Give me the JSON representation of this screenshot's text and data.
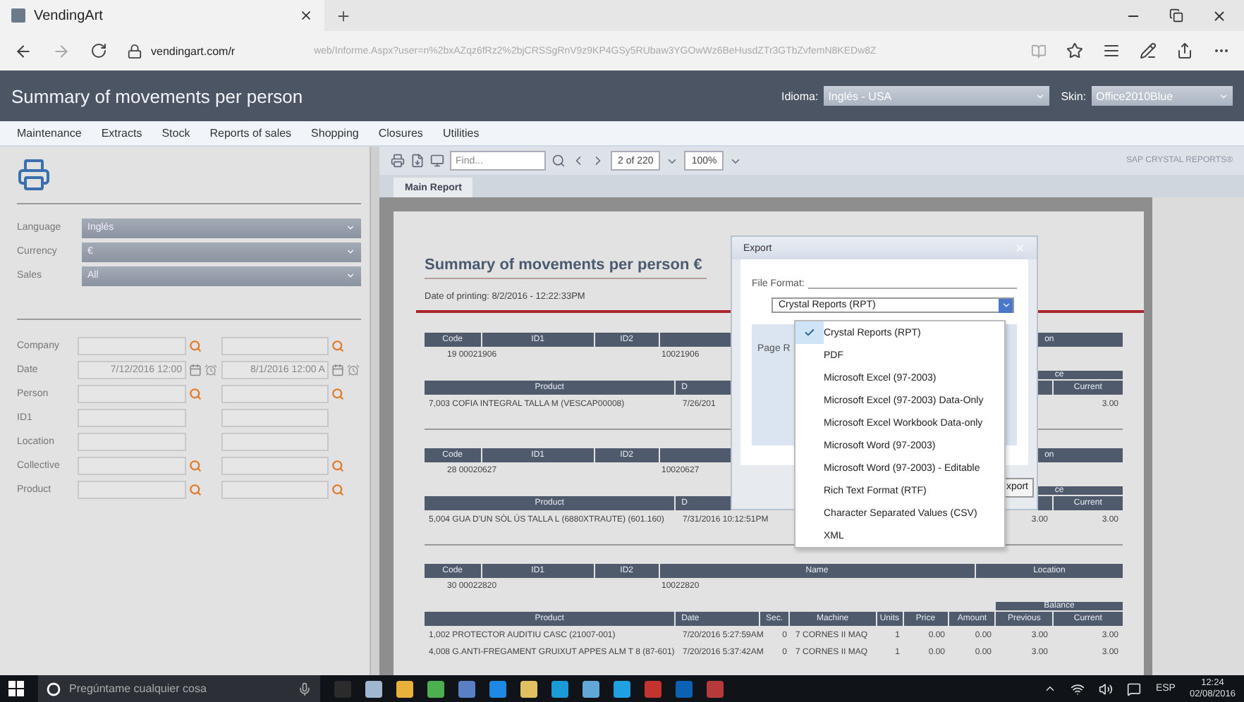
{
  "browser": {
    "tab_title": "VendingArt",
    "host": "vendingart.com/r",
    "path": "web/Informe.Aspx?user=n%2bxAZqz6fRz2%2bjCRSSgRnV9z9KP4GSy5RUbaw3YGOwWz6BeHusdZTr3GTbZvfemN8KEDw8Z"
  },
  "header": {
    "title": "Summary of movements per person",
    "language_label": "Idioma:",
    "language": "Inglés - USA",
    "skin_label": "Skin:",
    "skin": "Office2010Blue"
  },
  "menu": [
    "Maintenance",
    "Extracts",
    "Stock",
    "Reports of sales",
    "Shopping",
    "Closures",
    "Utilities"
  ],
  "options": [
    {
      "label": "Language",
      "value": "Inglés"
    },
    {
      "label": "Currency",
      "value": "€"
    },
    {
      "label": "Sales",
      "value": "All"
    }
  ],
  "filters": [
    {
      "label": "Company",
      "kind": "search"
    },
    {
      "label": "Date",
      "kind": "date",
      "from": "7/12/2016 12:00",
      "to": "8/1/2016 12:00 A"
    },
    {
      "label": "Person",
      "kind": "search"
    },
    {
      "label": "ID1",
      "kind": "text"
    },
    {
      "label": "Location",
      "kind": "text"
    },
    {
      "label": "Collective",
      "kind": "search"
    },
    {
      "label": "Product",
      "kind": "search"
    }
  ],
  "viewer": {
    "find_placeholder": "Find...",
    "page": "2 of 220",
    "zoom": "100%",
    "brand": "SAP CRYSTAL REPORTS®",
    "tab": "Main Report"
  },
  "report": {
    "title": "Summary of movements per person €",
    "printed": "Date of printing: 8/2/2016 - 12:22:33PM",
    "blocks": [
      {
        "header": {
          "code": "Code",
          "id1": "ID1",
          "id2": "ID2",
          "location": "on"
        },
        "ids": [
          "19 00021906",
          "10021906"
        ],
        "balance": "ce",
        "columns": {
          "product": "Product",
          "date": "D",
          "current": "Current"
        },
        "rows": [
          {
            "product": "7,003 COFIA INTEGRAL TALLA M (VESCAP00008)",
            "date": "7/26/201",
            "current": "3.00"
          }
        ]
      },
      {
        "header": {
          "code": "Code",
          "id1": "ID1",
          "id2": "ID2",
          "location": "on"
        },
        "ids": [
          "28 00020627",
          "10020627"
        ],
        "balance": "ce",
        "columns": {
          "product": "Product",
          "date": "D",
          "current": "Current"
        },
        "rows": [
          {
            "product": "5,004 GUA D'UN SÒL ÚS TALLA L (6880XTRAUTE) (601.160)",
            "date": "7/31/2016 10:12:51PM",
            "previous": "3.00",
            "current": "3.00"
          }
        ]
      },
      {
        "header": {
          "code": "Code",
          "id1": "ID1",
          "id2": "ID2",
          "name": "Name",
          "location": "Location"
        },
        "ids": [
          "30 00022820",
          "10022820"
        ],
        "balance": "Balance",
        "columns": {
          "product": "Product",
          "date": "Date",
          "sec": "Sec.",
          "machine": "Machine",
          "units": "Units",
          "price": "Price",
          "amount": "Amount",
          "previous": "Previous",
          "current": "Current"
        },
        "rows": [
          {
            "product": "1,002 PROTECTOR AUDITIU CASC (21007-001)",
            "date": "7/20/2016 5:27:59AM",
            "sec": "0",
            "machine": "7 CORNES II MAQ",
            "units": "1",
            "price": "0.00",
            "amount": "0.00",
            "previous": "3.00",
            "current": "3.00"
          },
          {
            "product": "4,008 G.ANTI-FREGAMENT GRUIXUT APPES ALM T 8 (87-601)",
            "date": "7/20/2016 5:37:42AM",
            "sec": "0",
            "machine": "7 CORNES II MAQ",
            "units": "1",
            "price": "0.00",
            "amount": "0.00",
            "previous": "3.00",
            "current": "3.00"
          }
        ]
      }
    ]
  },
  "export_dialog": {
    "title": "Export",
    "file_format_label": "File Format:",
    "format": "Crystal Reports (RPT)",
    "page_range_label": "Page R",
    "button": "xport",
    "options": [
      {
        "label": "Crystal Reports (RPT)",
        "selected": true
      },
      {
        "label": "PDF",
        "selected": false
      },
      {
        "label": "Microsoft Excel (97-2003)",
        "selected": false
      },
      {
        "label": "Microsoft Excel (97-2003) Data-Only",
        "selected": false
      },
      {
        "label": "Microsoft Excel Workbook Data-only",
        "selected": false
      },
      {
        "label": "Microsoft Word (97-2003)",
        "selected": false
      },
      {
        "label": "Microsoft Word (97-2003) - Editable",
        "selected": false
      },
      {
        "label": "Rich Text Format (RTF)",
        "selected": false
      },
      {
        "label": "Character Separated Values (CSV)",
        "selected": false
      },
      {
        "label": "XML",
        "selected": false
      }
    ]
  },
  "taskbar": {
    "search_placeholder": "Pregúntame cualquier cosa",
    "language": "ESP",
    "time": "12:24",
    "date": "02/08/2016"
  }
}
